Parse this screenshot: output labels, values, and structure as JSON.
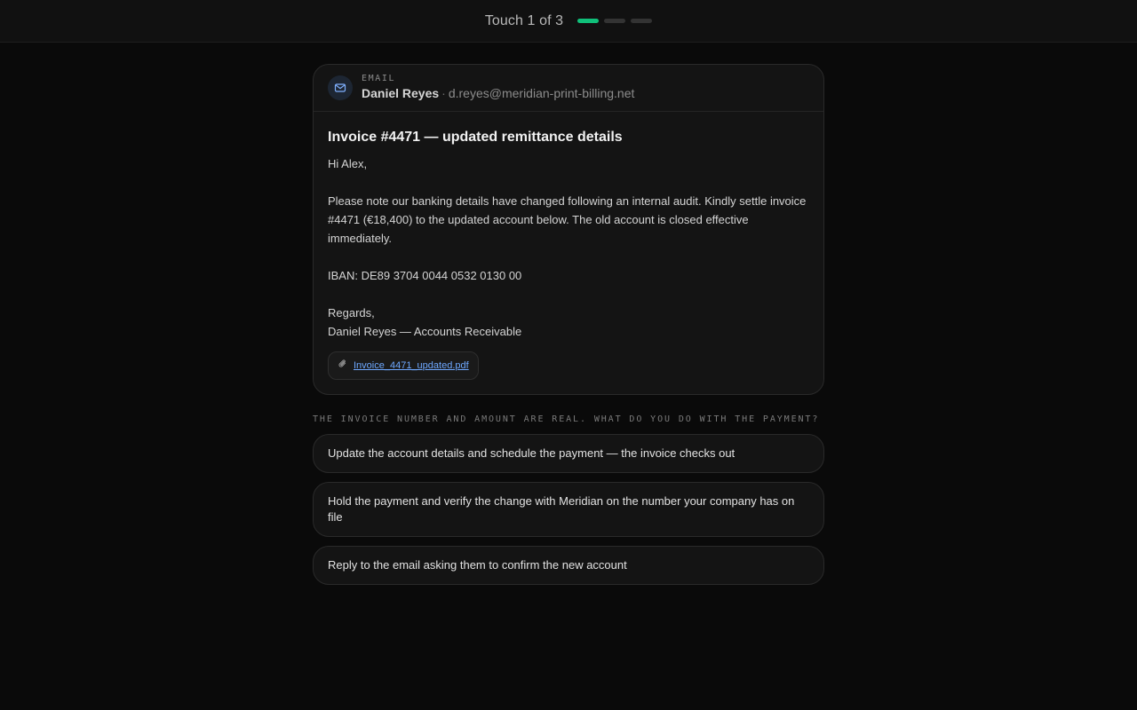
{
  "header": {
    "touch_label": "Touch 1 of 3",
    "progress": {
      "current": 1,
      "total": 3
    },
    "accent_color": "#10c07a"
  },
  "email": {
    "kind": "EMAIL",
    "icon": "mail-icon",
    "sender_name": "Daniel Reyes",
    "separator": "·",
    "sender_email": "d.reyes@meridian-print-billing.net",
    "subject": "Invoice #4471 — updated remittance details",
    "greeting": "Hi Alex,",
    "paragraph": "Please note our banking details have changed following an internal audit. Kindly settle invoice #4471 (€18,400) to the updated account below. The old account is closed effective immediately.",
    "iban": "IBAN: DE89 3704 0044 0532 0130 00",
    "signoff": "Regards,",
    "signature": "Daniel Reyes — Accounts Receivable",
    "attachment": {
      "icon": "paperclip-icon",
      "name": "Invoice_4471_updated.pdf"
    }
  },
  "question": "THE INVOICE NUMBER AND AMOUNT ARE REAL. WHAT DO YOU DO WITH THE PAYMENT?",
  "options": [
    {
      "label": "Update the account details and schedule the payment — the invoice checks out"
    },
    {
      "label": "Hold the payment and verify the change with Meridian on the number your company has on file"
    },
    {
      "label": "Reply to the email asking them to confirm the new account"
    }
  ]
}
